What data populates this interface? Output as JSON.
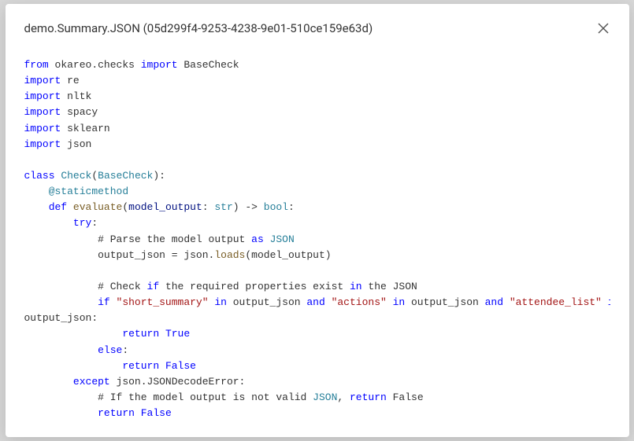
{
  "header": {
    "title": "demo.Summary.JSON (05d299f4-9253-4238-9e01-510ce159e63d)"
  },
  "code": {
    "line1_from": "from",
    "line1_mod": " okareo.checks ",
    "line1_import": "import",
    "line1_name": " BaseCheck",
    "line2_import": "import",
    "line2_mod": " re",
    "line3_import": "import",
    "line3_mod": " nltk",
    "line4_import": "import",
    "line4_mod": " spacy",
    "line5_import": "import",
    "line5_mod": " sklearn",
    "line6_import": "import",
    "line6_mod": " json",
    "blank1": "",
    "line7_class": "class",
    "line7_name": " Check",
    "line7_paren": "(",
    "line7_base": "BaseCheck",
    "line7_end": "):",
    "line8_dec": "    @staticmethod",
    "line9_def": "    def",
    "line9_name": " evaluate",
    "line9_p1": "(",
    "line9_arg": "model_output",
    "line9_colon": ": ",
    "line9_type": "str",
    "line9_arrow": ") -> ",
    "line9_ret": "bool",
    "line9_end": ":",
    "line10_try": "        try",
    "line10_colon": ":",
    "line11_comment_pre": "            # Parse the model output ",
    "line11_as": "as",
    "line11_json": " JSON",
    "line12_pre": "            output_json = json.",
    "line12_loads": "loads",
    "line12_post": "(model_output)",
    "blank2": "",
    "line13_pre": "            # Check ",
    "line13_if": "if",
    "line13_mid": " the required properties exist ",
    "line13_in": "in",
    "line13_post": " the JSON",
    "line14_if": "            if",
    "line14_s1": " \"short_summary\"",
    "line14_in1": " in",
    "line14_o1": " output_json ",
    "line14_and1": "and",
    "line14_s2": " \"actions\"",
    "line14_in2": " in",
    "line14_o2": " output_json ",
    "line14_and2": "and",
    "line14_s3": " \"attendee_list\"",
    "line14_in3": " in",
    "line14_end": "",
    "line14b": "output_json:",
    "line15_ret": "                return",
    "line15_val": " True",
    "line16_else": "            else",
    "line16_colon": ":",
    "line17_ret": "                return",
    "line17_val": " False",
    "line18_except": "        except",
    "line18_exc": " json.JSONDecodeError:",
    "line19_pre": "            # If the model output is not valid ",
    "line19_json": "JSON",
    "line19_comma": ", ",
    "line19_ret": "return",
    "line19_post": " False",
    "line20_ret": "            return",
    "line20_val": " False"
  }
}
